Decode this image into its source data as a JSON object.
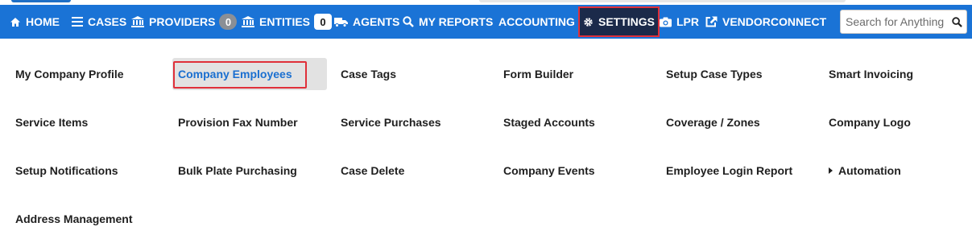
{
  "nav": {
    "home": "HOME",
    "cases": "CASES",
    "providers": "PROVIDERS",
    "providers_count": "0",
    "entities": "ENTITIES",
    "entities_count": "0",
    "agents": "AGENTS",
    "my_reports": "MY REPORTS",
    "accounting": "ACCOUNTING",
    "settings": "SETTINGS",
    "lpr": "LPR",
    "vendorconnect": "VENDORCONNECT",
    "search_placeholder": "Search for Anything"
  },
  "settings_menu": {
    "active_item": "Company Employees",
    "items": [
      "My Company Profile",
      "Company Employees",
      "Case Tags",
      "Form Builder",
      "Setup Case Types",
      "Smart Invoicing",
      "Service Items",
      "Provision Fax Number",
      "Service Purchases",
      "Staged Accounts",
      "Coverage / Zones",
      "Company Logo",
      "Setup Notifications",
      "Bulk Plate Purchasing",
      "Case Delete",
      "Company Events",
      "Employee Login Report",
      "Automation",
      "Address Management"
    ]
  },
  "colors": {
    "navbar": "#1a73d6",
    "settings_bg": "#1b2a4a",
    "highlight_red": "#e0303a",
    "active_link": "#1a6fd0"
  }
}
